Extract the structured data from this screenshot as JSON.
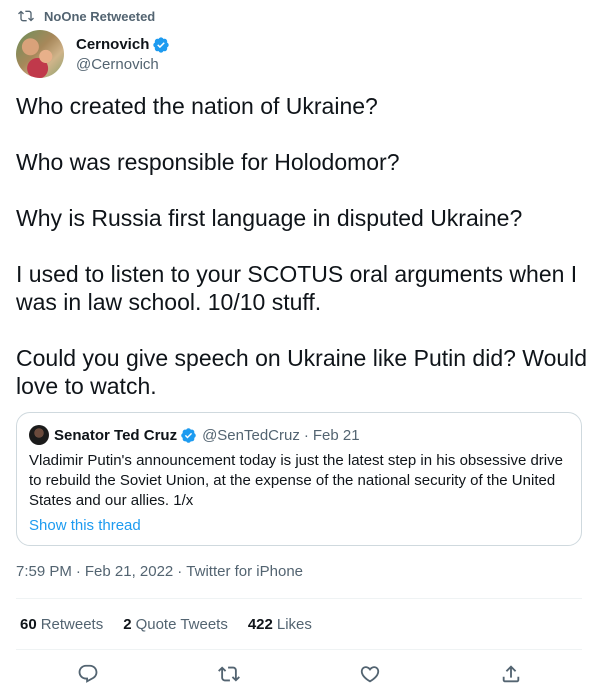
{
  "retweet": {
    "label": "NoOne Retweeted",
    "icon": "retweet-icon"
  },
  "author": {
    "display_name": "Cernovich",
    "handle": "@Cernovich",
    "verified": true
  },
  "tweet": {
    "text": "Who created the nation of Ukraine?\n\nWho was responsible for Holodomor?\n\nWhy is Russia first language in disputed Ukraine?\n\nI used to listen to your SCOTUS oral arguments when I was in law school. 10/10 stuff.\n\nCould you give speech on Ukraine like Putin did? Would love to watch."
  },
  "quote": {
    "display_name": "Senator Ted Cruz",
    "handle": "@SenTedCruz",
    "separator": "·",
    "date": "Feb 21",
    "text": "Vladimir Putin's announcement today is just the latest step in his obsessive drive to rebuild the Soviet Union, at the expense of the national security of the United States and our allies. 1/x",
    "thread_link": "Show this thread"
  },
  "meta": {
    "time": "7:59 PM",
    "date": "Feb 21, 2022",
    "source": "Twitter for iPhone",
    "separator": "·"
  },
  "stats": [
    {
      "count": "60",
      "label": "Retweets"
    },
    {
      "count": "2",
      "label": "Quote Tweets"
    },
    {
      "count": "422",
      "label": "Likes"
    }
  ],
  "actions": [
    "reply-icon",
    "retweet-icon",
    "like-icon",
    "share-icon"
  ],
  "colors": {
    "accent": "#1d9bf0",
    "muted": "#536471",
    "text": "#0f1419",
    "border": "#cfd9de"
  }
}
